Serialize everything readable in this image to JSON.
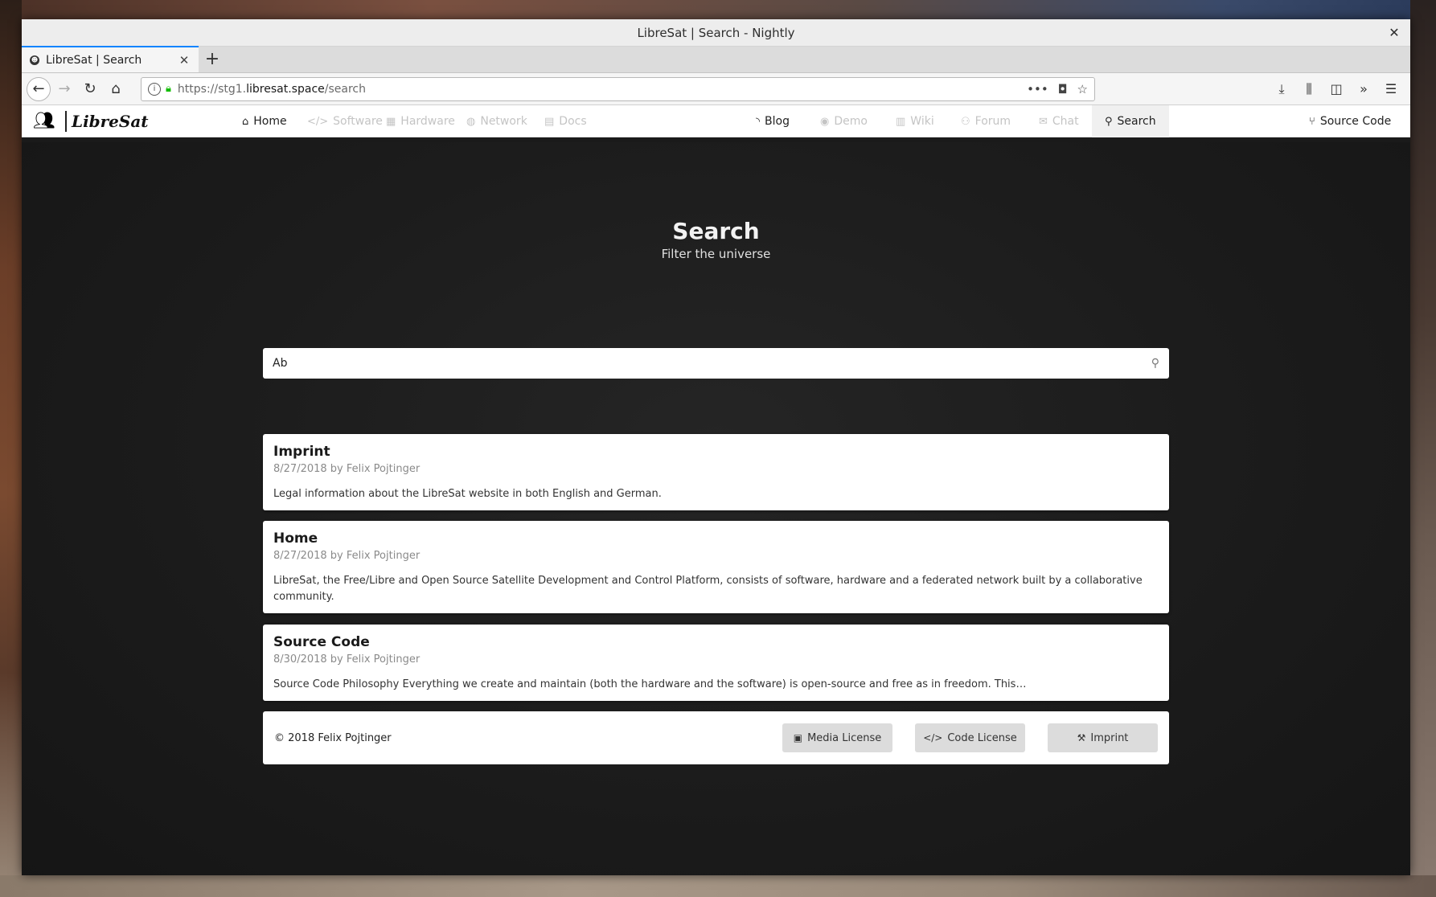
{
  "window": {
    "title": "LibreSat | Search - Nightly",
    "close_glyph": "✕"
  },
  "tab": {
    "label": "LibreSat | Search",
    "close_glyph": "✕",
    "new_tab_glyph": "+"
  },
  "address": {
    "prefix": "https://stg1.",
    "domain": "libresat.space",
    "path": "/search"
  },
  "site": {
    "logo_text": "LibreSat",
    "nav": [
      {
        "label": "Home",
        "icon": "home-icon",
        "state": "active"
      },
      {
        "label": "Software",
        "icon": "code-icon",
        "state": "disabled"
      },
      {
        "label": "Hardware",
        "icon": "microchip-icon",
        "state": "disabled"
      },
      {
        "label": "Network",
        "icon": "globe-icon",
        "state": "disabled"
      },
      {
        "label": "Docs",
        "icon": "book-icon",
        "state": "disabled"
      },
      {
        "label": "Blog",
        "icon": "rss-icon",
        "state": "active"
      },
      {
        "label": "Demo",
        "icon": "eye-icon",
        "state": "disabled"
      },
      {
        "label": "Wiki",
        "icon": "wiki-icon",
        "state": "disabled"
      },
      {
        "label": "Forum",
        "icon": "users-icon",
        "state": "disabled"
      },
      {
        "label": "Chat",
        "icon": "chat-icon",
        "state": "disabled"
      },
      {
        "label": "Search",
        "icon": "search-icon",
        "state": "current"
      },
      {
        "label": "Source Code",
        "icon": "branch-icon",
        "state": "active"
      }
    ]
  },
  "hero": {
    "title": "Search",
    "subtitle": "Filter the universe"
  },
  "search": {
    "value": "Ab"
  },
  "results": [
    {
      "title": "Imprint",
      "meta": "8/27/2018 by Felix Pojtinger",
      "desc": "Legal information about the LibreSat website in both English and German."
    },
    {
      "title": "Home",
      "meta": "8/27/2018 by Felix Pojtinger",
      "desc": "LibreSat, the Free/Libre and Open Source Satellite Development and Control Platform, consists of software, hardware and a federated network built by a collaborative community."
    },
    {
      "title": "Source Code",
      "meta": "8/30/2018 by Felix Pojtinger",
      "desc": "Source Code Philosophy Everything we create and maintain (both the hardware and the software) is open-source and free as in freedom. This…"
    }
  ],
  "footer": {
    "copyright": "© 2018 Felix Pojtinger",
    "buttons": [
      {
        "label": "Media License",
        "icon": "images-icon"
      },
      {
        "label": "Code License",
        "icon": "code-icon"
      },
      {
        "label": "Imprint",
        "icon": "gavel-icon"
      }
    ]
  },
  "colors": {
    "accent": "#0a84ff",
    "secure_lock": "#12bc00",
    "hero_bg": "#1c1c1c"
  }
}
